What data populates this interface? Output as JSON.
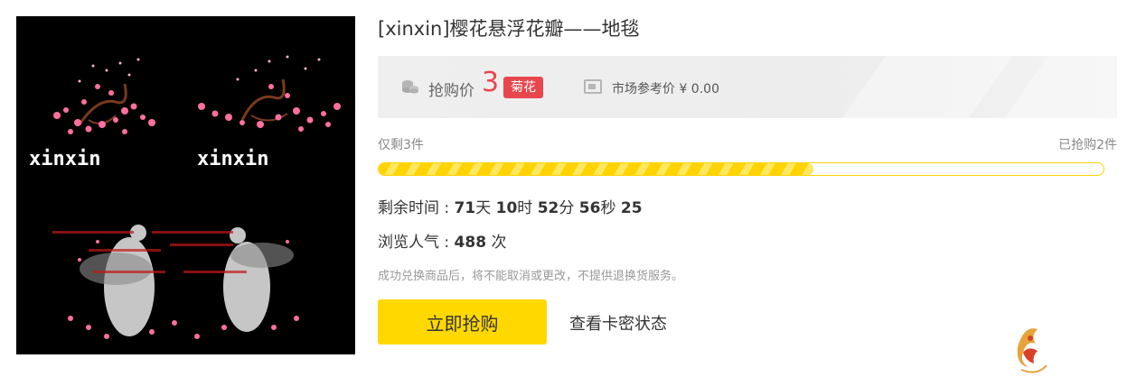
{
  "product": {
    "title": "[xinxin]樱花悬浮花瓣——地毯",
    "image_caption_left": "xinxin",
    "image_caption_right": "xinxin"
  },
  "price": {
    "label": "抢购价",
    "value": "3",
    "currency": "菊花",
    "market_label": "市场参考价 ¥ 0.00",
    "accent_color": "#e8464d"
  },
  "stock": {
    "remaining_text": "仅剩3件",
    "sold_text": "已抢购2件",
    "progress_fraction": 0.6,
    "bar_color": "#ffd300"
  },
  "countdown": {
    "label": "剩余时间 : ",
    "days": "71",
    "days_unit": "天 ",
    "hours": "10",
    "hours_unit": "时 ",
    "minutes": "52",
    "minutes_unit": "分 ",
    "seconds": "56",
    "seconds_unit": "秒 ",
    "fraction": "25"
  },
  "views": {
    "label": "浏览人气 : ",
    "count": "488",
    "unit": " 次"
  },
  "notice": "成功兑换商品后，将不能取消或更改，不提供退换货服务。",
  "actions": {
    "buy_label": "立即抢购",
    "card_status_label": "查看卡密状态",
    "buy_color": "#ffd800"
  },
  "icons": {
    "price": "coins-icon",
    "market": "price-tag-icon"
  }
}
